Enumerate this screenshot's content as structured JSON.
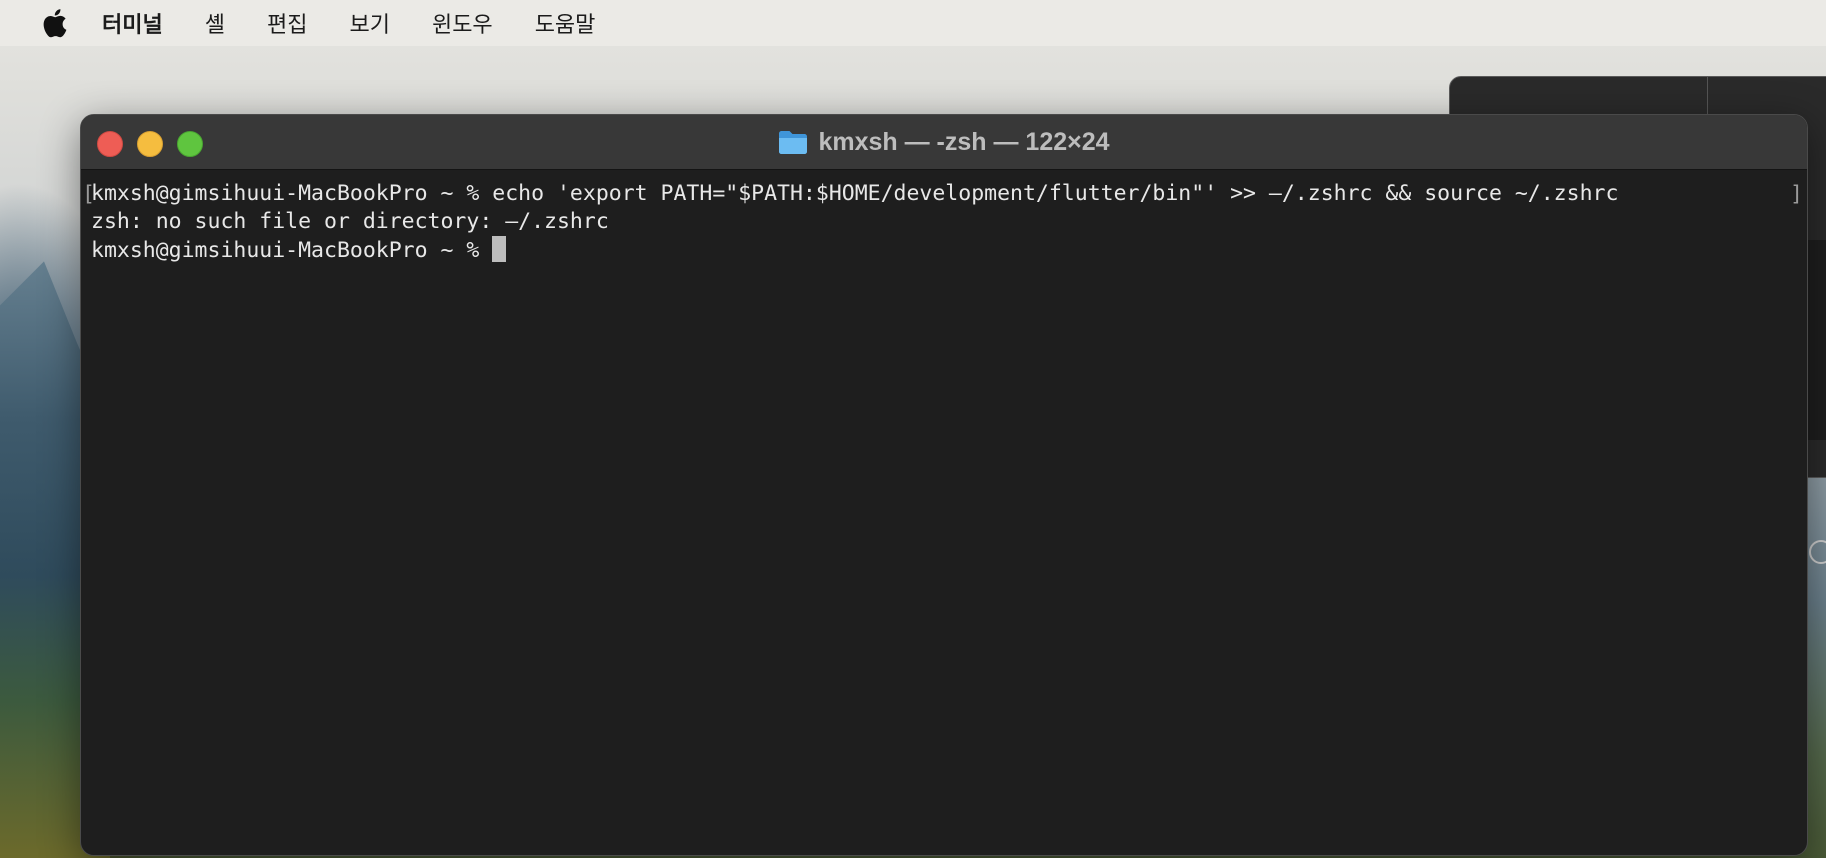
{
  "menubar": {
    "apple_icon": "apple-logo-icon",
    "items": [
      "터미널",
      "셸",
      "편집",
      "보기",
      "윈도우",
      "도움말"
    ]
  },
  "terminal": {
    "title": "kmxsh — -zsh — 122×24",
    "folder_icon": "folder-icon",
    "lines": [
      "kmxsh@gimsihuui-MacBookPro ~ % echo 'export PATH=\"$PATH:$HOME/development/flutter/bin\"' >> –/.zshrc && source ~/.zshrc",
      "zsh: no such file or directory: –/.zshrc",
      "kmxsh@gimsihuui-MacBookPro ~ % "
    ],
    "bracket_left": "[",
    "bracket_right": "]"
  },
  "colors": {
    "terminal_bg": "#1e1e1e",
    "titlebar_bg": "#383838",
    "close": "#ee5d55",
    "minimize": "#f5bd3f",
    "maximize": "#5fc53f",
    "text": "#e8e8e8"
  }
}
